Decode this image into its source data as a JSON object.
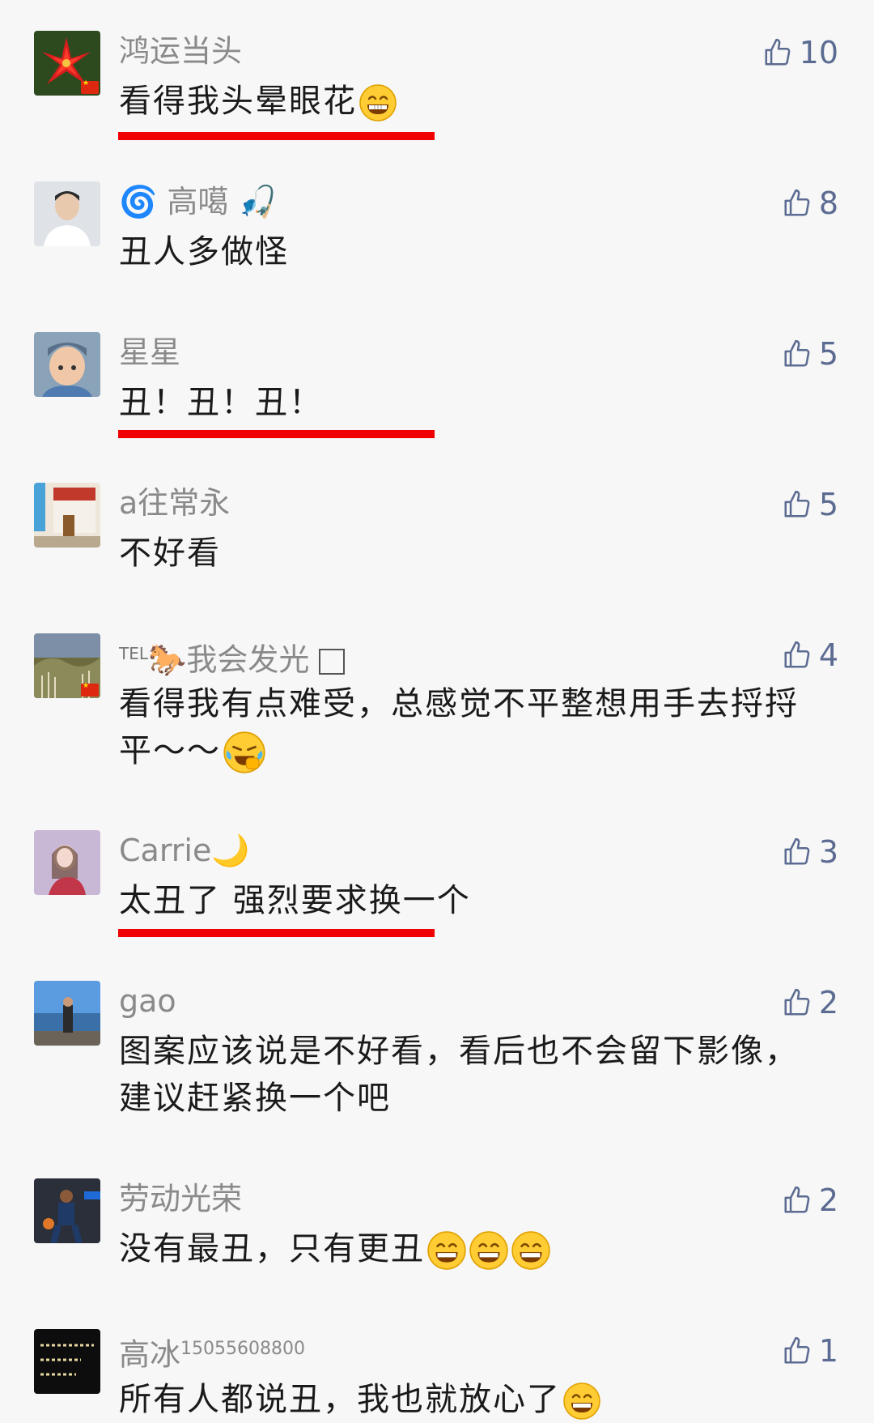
{
  "comments": [
    {
      "username": "鸿运当头",
      "text": "看得我头晕眼花",
      "likes": "10",
      "emojis": [
        "grin-emoji"
      ],
      "underlined": true,
      "avatar": "red-flower",
      "flag": true
    },
    {
      "username": "高噶",
      "text": "丑人多做怪",
      "likes": "8",
      "emojis": [],
      "underlined": false,
      "avatar": "young-man",
      "flag": false
    },
    {
      "username": "星星",
      "text": "丑！丑！丑！",
      "likes": "5",
      "emojis": [],
      "underlined": true,
      "avatar": "child",
      "flag": false
    },
    {
      "username": "a往常永",
      "text": "不好看",
      "likes": "5",
      "emojis": [],
      "underlined": false,
      "avatar": "shop",
      "flag": false
    },
    {
      "username_prefix": "TEL",
      "username": "我会发光",
      "text": "看得我有点难受，总感觉不平整想用手去捋捋平～～",
      "likes": "4",
      "emojis": [
        "laugh-cry-emoji"
      ],
      "underlined": false,
      "avatar": "landscape",
      "flag": true
    },
    {
      "username": "Carrie",
      "text": "太丑了 强烈要求换一个",
      "likes": "3",
      "emojis": [],
      "underlined": true,
      "avatar": "girl",
      "flag": false
    },
    {
      "username": "gao",
      "text": "图案应该说是不好看，看后也不会留下影像，建议赶紧换一个吧",
      "likes": "2",
      "emojis": [],
      "underlined": false,
      "avatar": "seaside",
      "flag": false
    },
    {
      "username": "劳动光荣",
      "text": "没有最丑，只有更丑",
      "likes": "2",
      "emojis": [
        "grin-emoji",
        "grin-emoji",
        "grin-emoji"
      ],
      "underlined": false,
      "avatar": "basketball",
      "flag": false
    },
    {
      "username": "高冰",
      "username_sup": "15055608800",
      "text": "所有人都说丑，我也就放心了",
      "likes": "1",
      "emojis": [
        "grin-emoji"
      ],
      "underlined": false,
      "avatar": "dark-text",
      "flag": false
    }
  ],
  "colors": {
    "background": "#f7f7f7",
    "username": "#8a8a8a",
    "text": "#1a1a1a",
    "like": "#5b6b91",
    "underline": "#f00000"
  }
}
